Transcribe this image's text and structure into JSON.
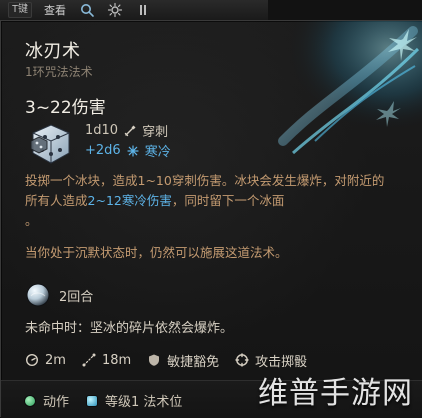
{
  "top_bar": {
    "tag": "T键",
    "look": "查看"
  },
  "spell": {
    "name": "冰刃术",
    "school": "1环咒法法术",
    "damage": "3~22伤害",
    "dice": {
      "line1": "1d10",
      "line1_type": "穿刺",
      "line2": "+2d6",
      "line2_type": "寒冷"
    },
    "description": {
      "part1": "投掷一个冰块，造成1~10穿刺伤害。冰块会发生爆炸，对附近的所有人造成",
      "part2_cold": "2~12寒冷伤害",
      "part3": "，同时留下一个冰面",
      "tail": "。"
    },
    "description2": "当你处于沉默状态时，仍然可以施展这道法术。",
    "duration": "2回合",
    "on_miss": "未命中时：坚冰的碎片依然会爆炸。",
    "stats": {
      "radius": "2m",
      "range": "18m",
      "save": "敏捷豁免",
      "attack": "攻击掷骰"
    },
    "footer": {
      "action": "动作",
      "level": "等级1 法术位"
    }
  },
  "watermark": {
    "text": "维普手游网"
  },
  "colors": {
    "cold_blue": "#5db3e7",
    "text_gold": "#c49b71",
    "panel_bg": "#141414"
  },
  "icons": {
    "search": "search-icon",
    "gear": "gear-icon",
    "pause": "pause-icon",
    "sword": "sword-icon",
    "snow": "snowflake-icon",
    "dice": "dice-icon",
    "orb": "orb-icon",
    "clock": "clock-icon",
    "range": "range-icon",
    "shield": "shield-icon",
    "target": "target-icon"
  }
}
